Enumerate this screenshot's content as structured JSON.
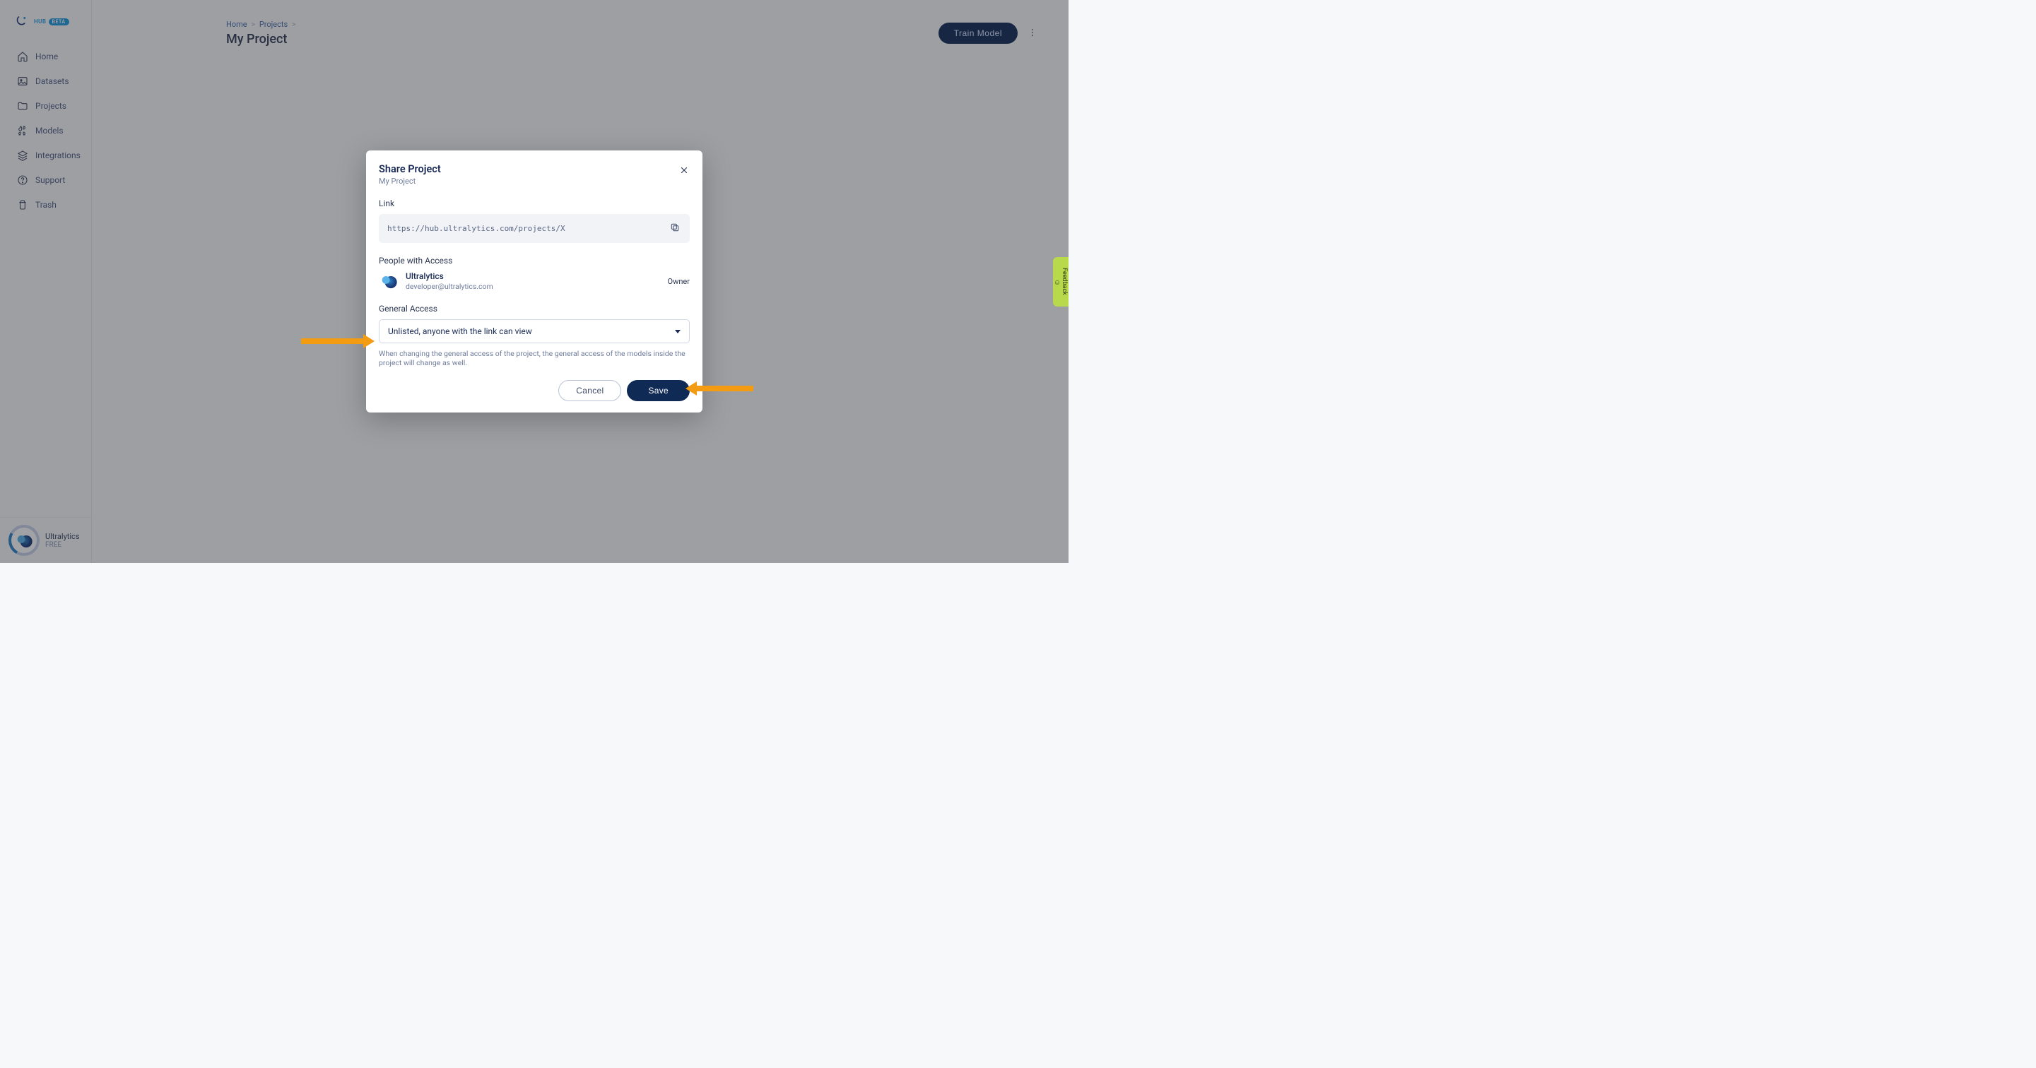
{
  "brand": {
    "name": "Ultralytics",
    "sub": "HUB",
    "badge": "BETA"
  },
  "sidebar": {
    "items": [
      {
        "label": "Home",
        "name": "sidebar-item-home",
        "icon": "home-icon"
      },
      {
        "label": "Datasets",
        "name": "sidebar-item-datasets",
        "icon": "image-icon"
      },
      {
        "label": "Projects",
        "name": "sidebar-item-projects",
        "icon": "folder-icon"
      },
      {
        "label": "Models",
        "name": "sidebar-item-models",
        "icon": "command-icon"
      },
      {
        "label": "Integrations",
        "name": "sidebar-item-integrations",
        "icon": "layers-icon"
      },
      {
        "label": "Support",
        "name": "sidebar-item-support",
        "icon": "help-icon"
      },
      {
        "label": "Trash",
        "name": "sidebar-item-trash",
        "icon": "trash-icon"
      }
    ],
    "user": {
      "name": "Ultralytics",
      "tier": "FREE"
    }
  },
  "breadcrumb": {
    "home": "Home",
    "projects": "Projects"
  },
  "page": {
    "title": "My Project",
    "train_button": "Train Model"
  },
  "modal": {
    "title": "Share Project",
    "subtitle": "My Project",
    "link_label": "Link",
    "link_value": "https://hub.ultralytics.com/projects/X",
    "people_label": "People with Access",
    "person": {
      "name": "Ultralytics",
      "email": "developer@ultralytics.com",
      "role": "Owner"
    },
    "general_label": "General Access",
    "access_option": "Unlisted, anyone with the link can view",
    "access_note": "When changing the general access of the project, the general access of the models inside the project will change as well.",
    "cancel": "Cancel",
    "save": "Save"
  },
  "feedback": {
    "label": "Feedback"
  },
  "colors": {
    "primary": "#102a56",
    "accent": "#f39c12"
  }
}
